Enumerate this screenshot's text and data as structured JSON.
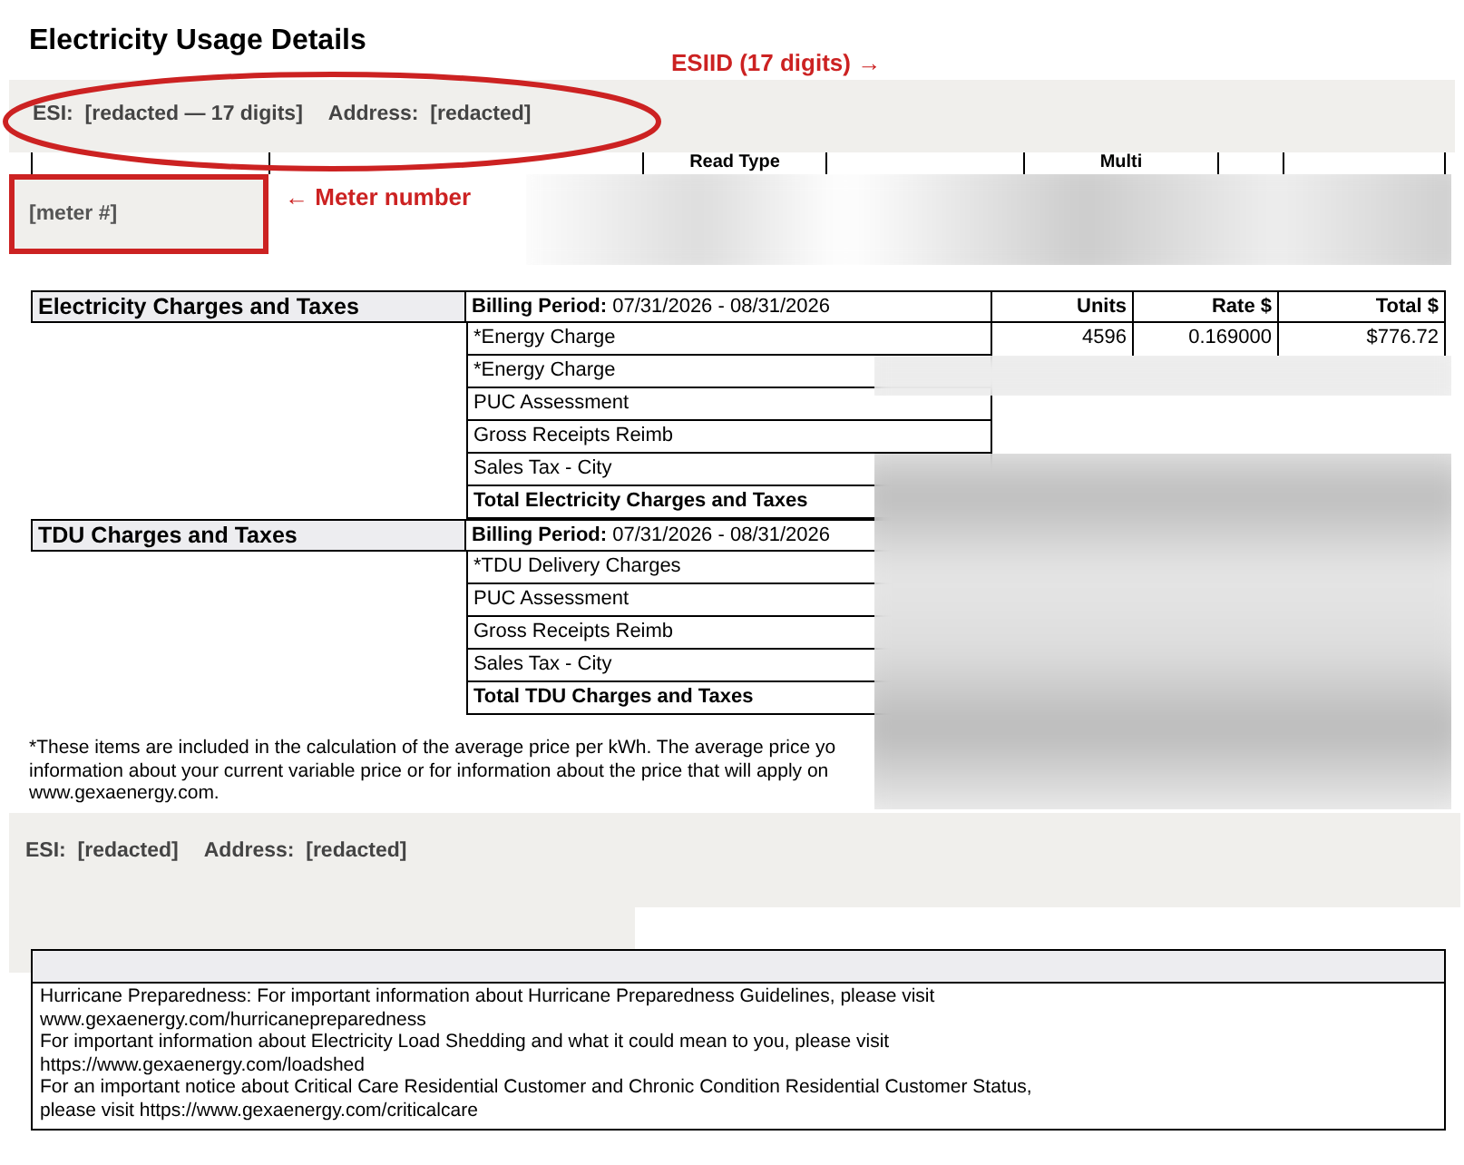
{
  "title": "Electricity Usage Details",
  "annotations": [
    {
      "kind": "esiid",
      "text": "ESIID (17 digits) →"
    },
    {
      "kind": "meter",
      "text": "← Meter number"
    }
  ],
  "service_banners": [
    {
      "esi_label": "ESI:",
      "esi_value": "[redacted — 17 digits]",
      "address_label": "Address:",
      "address_value": "[redacted]"
    },
    {
      "esi_label": "ESI:",
      "esi_value": "[redacted]",
      "address_label": "Address:",
      "address_value": "[redacted]"
    }
  ],
  "usage_table": {
    "columns": [
      "Read Type",
      "Multi"
    ],
    "meter_number": "[meter #]"
  },
  "charge_sections": [
    {
      "title": "Electricity Charges and Taxes",
      "billing_label": "Billing Period:",
      "billing_value": "07/31/2026 - 08/31/2026",
      "columns": [
        "Units",
        "Rate $",
        "Total $"
      ],
      "rows": [
        {
          "kind": "item",
          "label": "*Energy Charge",
          "units": "4596",
          "rate": "0.169000",
          "total": "$776.72"
        },
        {
          "kind": "item",
          "label": "*Energy Charge"
        },
        {
          "kind": "item",
          "label": "PUC Assessment"
        },
        {
          "kind": "item",
          "label": "Gross Receipts Reimb"
        },
        {
          "kind": "item",
          "label": "Sales Tax - City"
        },
        {
          "kind": "total",
          "label": "Total Electricity Charges and Taxes"
        }
      ]
    },
    {
      "title": "TDU Charges and Taxes",
      "billing_label": "Billing Period:",
      "billing_value": "07/31/2026 - 08/31/2026",
      "rows": [
        {
          "kind": "item",
          "label": "*TDU Delivery Charges"
        },
        {
          "kind": "item",
          "label": "PUC Assessment"
        },
        {
          "kind": "item",
          "label": "Gross Receipts Reimb"
        },
        {
          "kind": "item",
          "label": "Sales Tax - City"
        },
        {
          "kind": "total",
          "label": "Total TDU Charges and Taxes"
        }
      ]
    }
  ],
  "footnote": [
    "*These items are included in the calculation of the average price per kWh. The average price yo",
    "information about your current variable price or for information about the price that will apply on",
    "www.gexaenergy.com."
  ],
  "messages": [
    "Hurricane Preparedness: For important information about Hurricane Preparedness Guidelines, please visit",
    "www.gexaenergy.com/hurricanepreparedness",
    "For important information about Electricity Load Shedding and what it could mean to you, please visit",
    "https://www.gexaenergy.com/loadshed",
    "For an important notice about Critical Care Residential Customer and Chronic Condition Residential Customer Status,",
    "please visit https://www.gexaenergy.com/criticalcare"
  ]
}
